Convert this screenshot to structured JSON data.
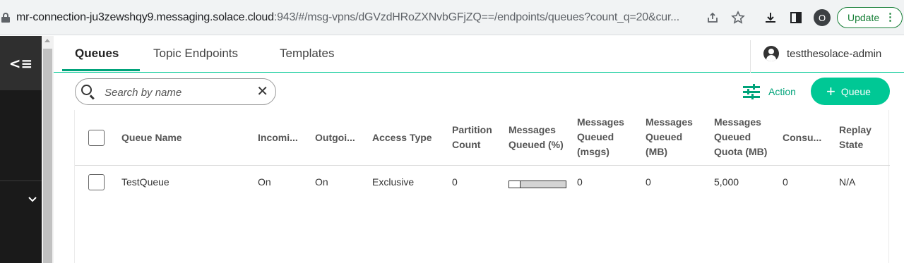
{
  "browser": {
    "url_host": "mr-connection-ju3zewshqy9.messaging.solace.cloud",
    "url_rest": ":943/#/msg-vpns/dGVzdHRoZXNvbGFjZQ==/endpoints/queues?count_q=20&cur...",
    "profile_initial": "O",
    "update_label": "Update"
  },
  "nav": {
    "collapse_glyph": "<≡",
    "chevron_glyph": "⌄"
  },
  "tabs": [
    {
      "label": "Queues",
      "active": true
    },
    {
      "label": "Topic Endpoints",
      "active": false
    },
    {
      "label": "Templates",
      "active": false
    }
  ],
  "user": {
    "name": "testthesolace-admin"
  },
  "search": {
    "placeholder": "Search by name"
  },
  "toolbar": {
    "action_label": "Action",
    "add_queue_label": "Queue"
  },
  "table": {
    "columns": {
      "name": "Queue Name",
      "incoming": "Incomi...",
      "outgoing": "Outgoi...",
      "access": "Access Type",
      "partition": [
        "Partition",
        "Count"
      ],
      "queued_pct": [
        "Messages",
        "Queued (%)"
      ],
      "queued_msgs": [
        "Messages",
        "Queued",
        "(msgs)"
      ],
      "queued_mb": [
        "Messages",
        "Queued",
        "(MB)"
      ],
      "quota": [
        "Messages",
        "Queued",
        "Quota (MB)"
      ],
      "consumers": "Consu...",
      "replay": [
        "Replay",
        "State"
      ]
    },
    "rows": [
      {
        "name": "TestQueue",
        "incoming": "On",
        "outgoing": "On",
        "access": "Exclusive",
        "partition": "0",
        "queued_pct_fraction": 0.2,
        "queued_msgs": "0",
        "queued_mb": "0",
        "quota": "5,000",
        "consumers": "0",
        "replay": "N/A"
      }
    ]
  }
}
